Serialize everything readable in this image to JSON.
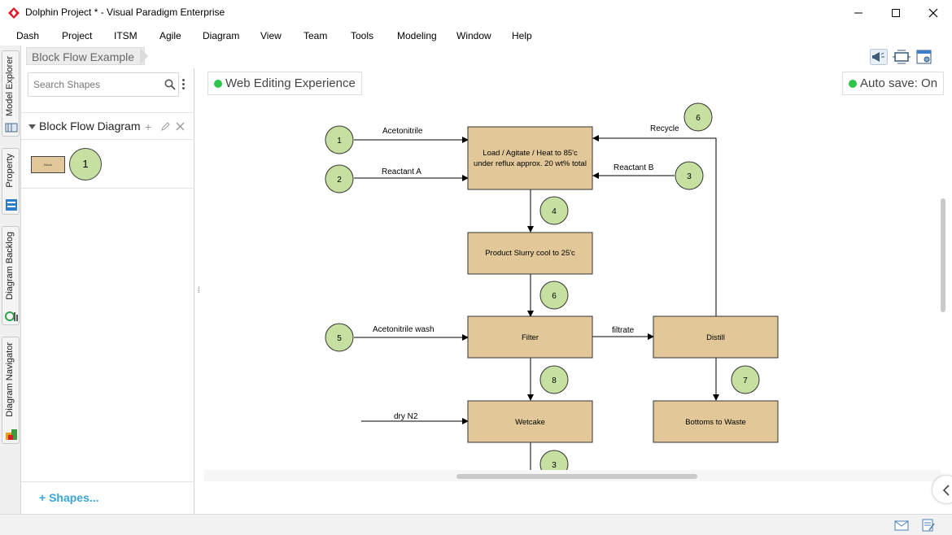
{
  "window": {
    "title": "Dolphin Project * - Visual Paradigm Enterprise",
    "minimize_icon": "minimize-icon",
    "maximize_icon": "maximize-icon",
    "close_icon": "close-icon"
  },
  "menu": [
    "Dash",
    "Project",
    "ITSM",
    "Agile",
    "Diagram",
    "View",
    "Team",
    "Tools",
    "Modeling",
    "Window",
    "Help"
  ],
  "left_tabs": [
    "Model Explorer",
    "Property",
    "Diagram Backlog",
    "Diagram Navigator"
  ],
  "breadcrumb": "Block Flow Example",
  "shapes_panel": {
    "search_placeholder": "Search Shapes",
    "section_title": "Block Flow Diagram",
    "shape_thumb_label": "Block",
    "shape_badge": "1",
    "shapes_link": "Shapes..."
  },
  "canvas": {
    "editing_label": "Web Editing Experience",
    "autosave_label": "Auto save: On",
    "status_color": "#2fc44a"
  },
  "diagram": {
    "blocks": {
      "load": [
        "Load / Agitate / Heat to 85'c",
        "under reflux approx. 20 wt% total"
      ],
      "slurry": "Product Slurry cool to 25'c",
      "filter": "Filter",
      "distill": "Distill",
      "wetcake": "Wetcake",
      "waste": "Bottoms to Waste"
    },
    "flows": {
      "acetonitrile": "Acetonitrile",
      "reactant_a": "Reactant A",
      "reactant_b": "Reactant B",
      "recycle": "Recycle",
      "acetonitrile_wash": "Acetonitrile wash",
      "filtrate": "filtrate",
      "dry_n2": "dry N2"
    },
    "streams": {
      "s1": "1",
      "s2": "2",
      "s3": "3",
      "s4": "4",
      "s5": "5",
      "s6_recycle": "6",
      "s6_slurry": "6",
      "s7": "7",
      "s8": "8",
      "s3_bottom": "3"
    },
    "colors": {
      "block_fill": "#e2c898",
      "stream_fill": "#c5e0a0"
    }
  }
}
